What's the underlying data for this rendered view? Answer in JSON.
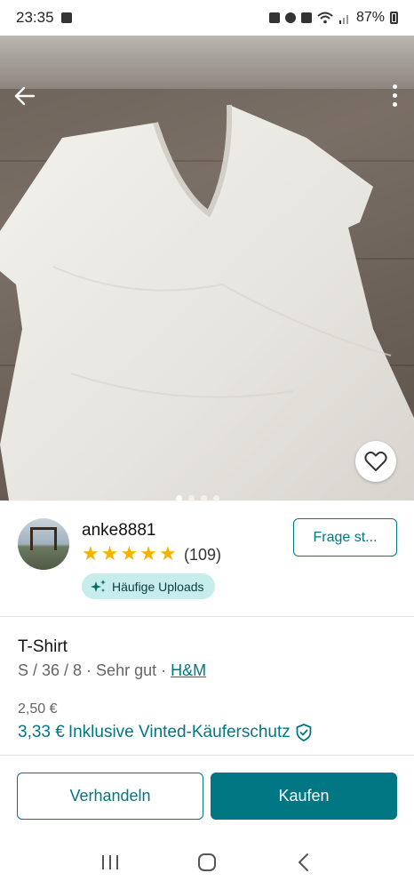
{
  "status_bar": {
    "time": "23:35",
    "battery": "87%"
  },
  "product": {
    "image_count": 4,
    "active_image_index": 0
  },
  "seller": {
    "username": "anke8881",
    "rating_stars": 5,
    "review_count": "(109)",
    "badge_label": "Häufige Uploads",
    "ask_button": "Frage st..."
  },
  "item": {
    "title": "T-Shirt",
    "size": "S / 36 / 8",
    "separator1": " · ",
    "condition": "Sehr gut",
    "separator2": " · ",
    "brand": "H&M",
    "price_base": "2,50 €",
    "price_total": "3,33 €",
    "price_protection": "Inklusive Vinted-Käuferschutz"
  },
  "actions": {
    "negotiate": "Verhandeln",
    "buy": "Kaufen"
  },
  "icons": {
    "back": "arrow-left-icon",
    "more": "more-vertical-icon",
    "favorite": "heart-icon",
    "badge": "sparkle-icon",
    "protection": "shield-check-icon"
  },
  "colors": {
    "accent": "#007782",
    "badge_bg": "#c6ecec",
    "star": "#f5b300"
  }
}
